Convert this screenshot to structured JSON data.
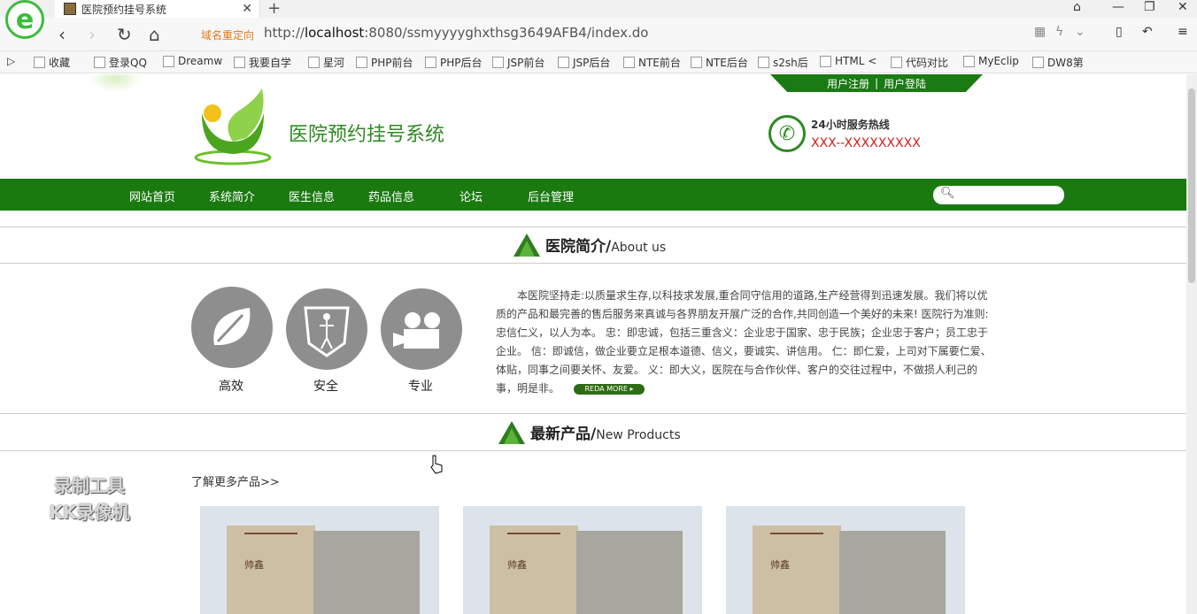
{
  "browser": {
    "tab_title": "医院预约挂号系统",
    "redirect_label": "域名重定向",
    "url_prefix": "http://",
    "url_host": "localhost",
    "url_rest": ":8080/ssmyyyyghxthsg3649AFB4/index.do",
    "bookmarks": [
      "收藏",
      "登录QQ",
      "Dreamw",
      "我要自学",
      "星河",
      "PHP前台",
      "PHP后台",
      "JSP前台",
      "JSP后台",
      "NTE前台",
      "NTE后台",
      "s2sh后",
      "HTML <",
      "代码对比",
      "MyEclip",
      "DW8第"
    ]
  },
  "site": {
    "top_links": {
      "register": "用户注册",
      "separator": "|",
      "login": "用户登陆"
    },
    "title": "医院预约挂号系统",
    "hotline_label": "24小时服务热线",
    "hotline_number": "XXX--XXXXXXXXX",
    "nav": [
      "网站首页",
      "系统简介",
      "医生信息",
      "药品信息",
      "论坛",
      "后台管理"
    ]
  },
  "about": {
    "heading_cn": "医院简介/",
    "heading_en": "About us",
    "features": [
      "高效",
      "安全",
      "专业"
    ],
    "text": "本医院坚持走:以质量求生存,以科技求发展,重合同守信用的道路,生产经营得到迅速发展。我们将以优质的产品和最完善的售后服务来真诚与各界朋友开展广泛的合作,共同创造一个美好的未来! 医院行为准则:忠信仁义，以人为本。 忠：即忠诚，包括三重含义：企业忠于国家、忠于民族；企业忠于客户；员工忠于企业。 信：即诚信，做企业要立足根本道德、信义，要诚实、讲信用。 仁：即仁爱，上司对下属要仁爱、体贴，同事之间要关怀、友爱。 义：即大义，医院在与合作伙伴、客户的交往过程中，不做损人利己的事，明是非。",
    "read_more": "REDA MORE ▸"
  },
  "products": {
    "heading_cn": "最新产品/",
    "heading_en": "New Products",
    "more_link": "了解更多产品>>",
    "brand_text": "帅鑫"
  },
  "watermark": {
    "line1": "录制工具",
    "line2": "KK录像机"
  },
  "colors": {
    "brand_green": "#1a7a10",
    "title_green": "#2e8a22",
    "hotline_red": "#d41d1d"
  }
}
